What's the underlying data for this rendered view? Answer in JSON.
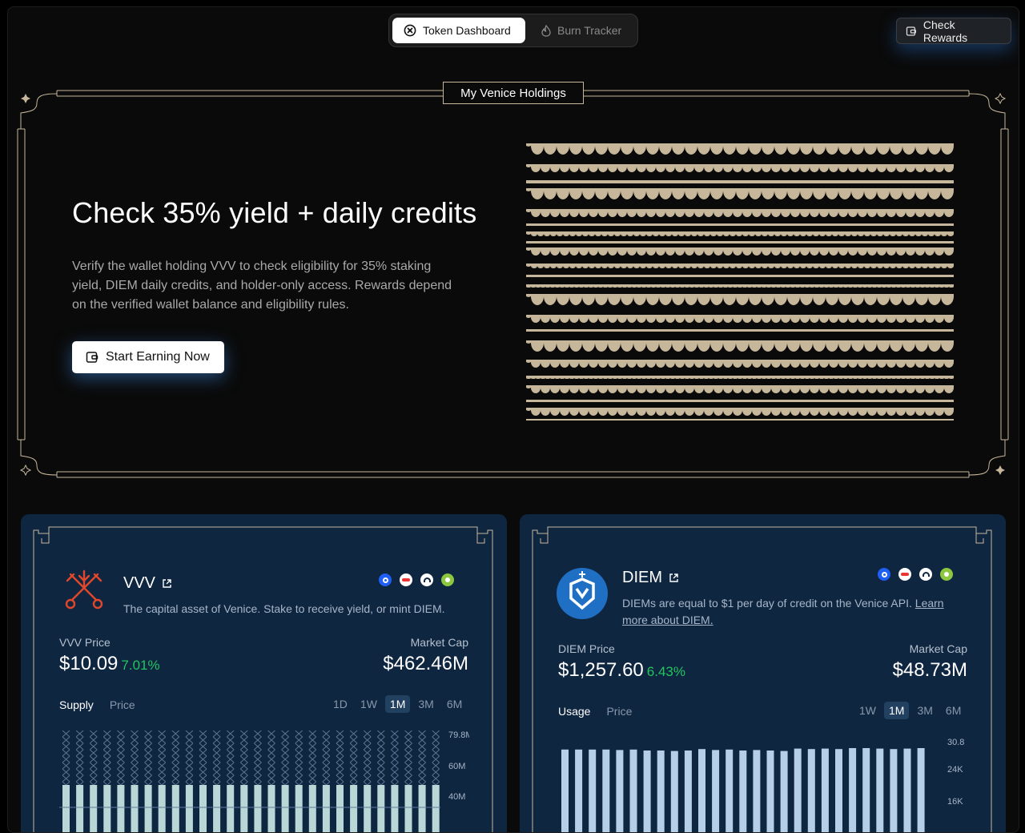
{
  "nav": {
    "tabs": [
      {
        "label": "Token Dashboard",
        "active": true,
        "icon": "venice-logo-icon"
      },
      {
        "label": "Burn Tracker",
        "active": false,
        "icon": "flame-icon"
      }
    ],
    "check_rewards": "Check Rewards"
  },
  "hero": {
    "section_title": "My Venice Holdings",
    "heading": "Check 35% yield + daily credits",
    "description": "Verify the wallet holding VVV to check eligibility for 35% staking yield, DIEM daily credits, and holder-only access. Rewards depend on the verified wallet balance and eligibility rules.",
    "cta": "Start Earning Now"
  },
  "cards": [
    {
      "name": "VVV",
      "description": "The capital asset of Venice. Stake to receive yield, or mint DIEM.",
      "price_label": "VVV Price",
      "price": "$10.09",
      "change": "7.01%",
      "mcap_label": "Market Cap",
      "mcap": "$462.46M",
      "chart_tabs": [
        "Supply",
        "Price"
      ],
      "ranges": [
        "1D",
        "1W",
        "1M",
        "3M",
        "6M"
      ],
      "active_range": "1M",
      "y_ticks": [
        "79.8M",
        "60M",
        "40M"
      ]
    },
    {
      "name": "DIEM",
      "description_prefix": "DIEMs are equal to $1 per day of credit on the Venice API. ",
      "description_link": "Learn more about DIEM.",
      "price_label": "DIEM Price",
      "price": "$1,257.60",
      "change": "6.43%",
      "mcap_label": "Market Cap",
      "mcap": "$48.73M",
      "chart_tabs": [
        "Usage",
        "Price"
      ],
      "ranges": [
        "1W",
        "1M",
        "3M",
        "6M"
      ],
      "active_range": "1M",
      "y_ticks": [
        "30.8",
        "24K",
        "16K"
      ]
    }
  ],
  "colors": {
    "accent_gold": "#c7b79a",
    "card_bg": "#0f2641",
    "positive": "#22c55e",
    "bar_light": "#b5cfe8",
    "bar_mint": "#b9d7d6"
  }
}
